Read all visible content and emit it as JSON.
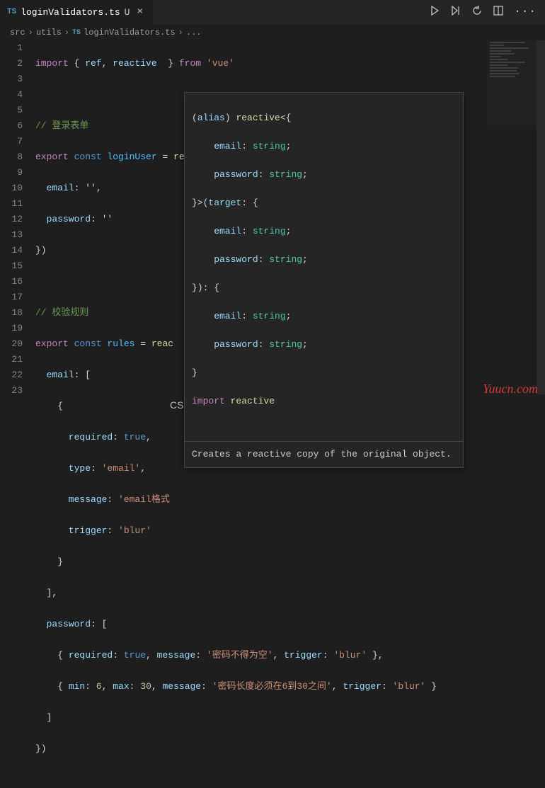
{
  "tab": {
    "icon": "TS",
    "title": "loginValidators.ts",
    "status": "U",
    "close": "×"
  },
  "actions": {
    "run": "run",
    "split_run": "split-run",
    "debug": "debug",
    "split": "split",
    "more": "···"
  },
  "breadcrumb": {
    "parts": [
      "src",
      "utils"
    ],
    "icon": "TS",
    "file": "loginValidators.ts",
    "tail": "..."
  },
  "code": {
    "l1_import": "import",
    "l1_brace1": " { ",
    "l1_ref": "ref",
    "l1_comma": ", ",
    "l1_reactive": "reactive",
    "l1_brace2": "  } ",
    "l1_from": "from",
    "l1_vue": " 'vue'",
    "l3_comment": "// 登录表单",
    "l4_export": "export",
    "l4_const": " const ",
    "l4_var": "loginUser",
    "l4_eq": " = ",
    "l4_reactive": "reactive",
    "l4_open": "({",
    "l5_prop": "  email",
    "l5_val": ": '',",
    "l6_prop": "  password",
    "l6_val": ": ''",
    "l7": "})",
    "l9_comment": "// 校验规则",
    "l10_export": "export",
    "l10_const": " const ",
    "l10_var": "rules",
    "l10_eq": " = ",
    "l10_reactive": "reac",
    "l11_prop": "  email",
    "l11_val": ": [",
    "l12": "    {",
    "l13_prop": "      required",
    "l13_val": ": ",
    "l13_true": "true",
    "l13_c": ",",
    "l14_prop": "      type",
    "l14_val": ": ",
    "l14_str": "'email'",
    "l14_c": ",",
    "l15_prop": "      message",
    "l15_val": ": ",
    "l15_str": "'email格式",
    "l16_prop": "      trigger",
    "l16_val": ": ",
    "l16_str": "'blur'",
    "l17": "    }",
    "l18": "  ],",
    "l19_prop": "  password",
    "l19_val": ": [",
    "l20a": "    { ",
    "l20_req": "required",
    "l20b": ": ",
    "l20_true": "true",
    "l20c": ", ",
    "l20_msg": "message",
    "l20d": ": ",
    "l20_str": "'密码不得为空'",
    "l20e": ", ",
    "l20_trg": "trigger",
    "l20f": ": ",
    "l20_blur": "'blur'",
    "l20g": " },",
    "l21a": "    { ",
    "l21_min": "min",
    "l21b": ": ",
    "l21_6": "6",
    "l21c": ", ",
    "l21_max": "max",
    "l21d": ": ",
    "l21_30": "30",
    "l21e": ", ",
    "l21_msg": "message",
    "l21f": ": ",
    "l21_str": "'密码长度必须在6到30之间'",
    "l21g": ", ",
    "l21_trg": "trigger",
    "l21h": ": ",
    "l21_blur": "'blur'",
    "l21i": " }",
    "l22": "  ]",
    "l23": "})"
  },
  "popup": {
    "l1a": "(",
    "l1_alias": "alias",
    "l1b": ") ",
    "l1_reactive": "reactive",
    "l1c": "<{",
    "l2_prop": "    email",
    "l2_c": ": ",
    "l2_type": "string",
    "l2_s": ";",
    "l3_prop": "    password",
    "l3_c": ": ",
    "l3_type": "string",
    "l3_s": ";",
    "l4": "}>(",
    "l4_target": "target",
    "l4b": ": {",
    "l5_prop": "    email",
    "l5_c": ": ",
    "l5_type": "string",
    "l5_s": ";",
    "l6_prop": "    password",
    "l6_c": ": ",
    "l6_type": "string",
    "l6_s": ";",
    "l7": "}): {",
    "l8_prop": "    email",
    "l8_c": ": ",
    "l8_type": "string",
    "l8_s": ";",
    "l9_prop": "    password",
    "l9_c": ": ",
    "l9_type": "string",
    "l9_s": ";",
    "l10": "}",
    "l11_import": "import",
    "l11_sp": " ",
    "l11_reactive": "reactive",
    "desc": "Creates a reactive copy of the original object."
  },
  "watermark": {
    "csdn": "CSDN @Sheldon一蓑烟雨任平生",
    "yuu": "Yuucn.com"
  },
  "lines": [
    "1",
    "2",
    "3",
    "4",
    "5",
    "6",
    "7",
    "8",
    "9",
    "10",
    "11",
    "12",
    "13",
    "14",
    "15",
    "16",
    "17",
    "18",
    "19",
    "20",
    "21",
    "22",
    "23"
  ]
}
